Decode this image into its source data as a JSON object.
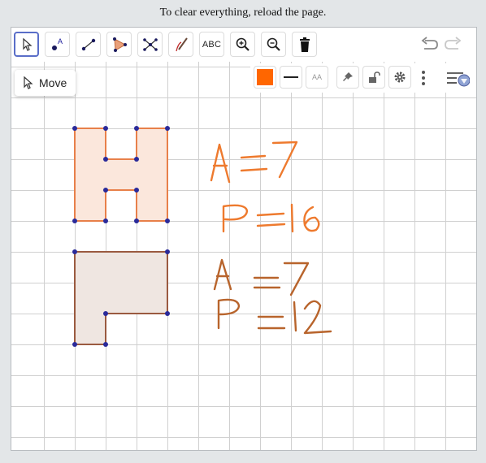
{
  "page": {
    "instructions": "To clear everything, reload the page."
  },
  "toolbar": {
    "tools": [
      {
        "name": "move",
        "icon": "cursor-arrow-icon",
        "active": true
      },
      {
        "name": "point",
        "icon": "point-icon"
      },
      {
        "name": "segment",
        "icon": "segment-icon"
      },
      {
        "name": "polygon",
        "icon": "polygon-icon"
      },
      {
        "name": "intersect",
        "icon": "intersect-icon"
      },
      {
        "name": "pen",
        "icon": "pen-icon"
      },
      {
        "name": "text",
        "label": "ABC",
        "icon": "text-icon"
      },
      {
        "name": "zoom-in",
        "icon": "zoom-in-icon"
      },
      {
        "name": "zoom-out",
        "icon": "zoom-out-icon"
      },
      {
        "name": "delete",
        "icon": "trash-icon"
      }
    ],
    "undo_icon": "undo-icon",
    "redo_icon": "redo-icon"
  },
  "tooltip": {
    "label": "Move",
    "icon": "cursor-arrow-icon"
  },
  "style_bar": {
    "color_swatch": "#ff6600",
    "line_style_icon": "line-style-icon",
    "text_size_label": "AA",
    "pin_icon": "pin-icon",
    "lock_icon": "unlock-icon",
    "settings_icon": "gear-icon",
    "more_icon": "more-vertical-icon",
    "toggle_icon": "style-bar-toggle-icon"
  },
  "canvas": {
    "grid_color": "#d0d0d0",
    "shape_h_color": "#e8804a",
    "shape_h_fill": "#fbe7dc",
    "shape_p_color": "#9a5a40",
    "shape_p_fill": "#efe6e1",
    "vertex_color": "#2a2a9a",
    "handwriting_color_1": "#ee7a2e",
    "handwriting_color_2": "#b8642c"
  },
  "annotations": {
    "area_1": "A = 7",
    "perimeter_1": "P = 16",
    "area_2": "A = 7",
    "perimeter_2": "P = 12"
  }
}
